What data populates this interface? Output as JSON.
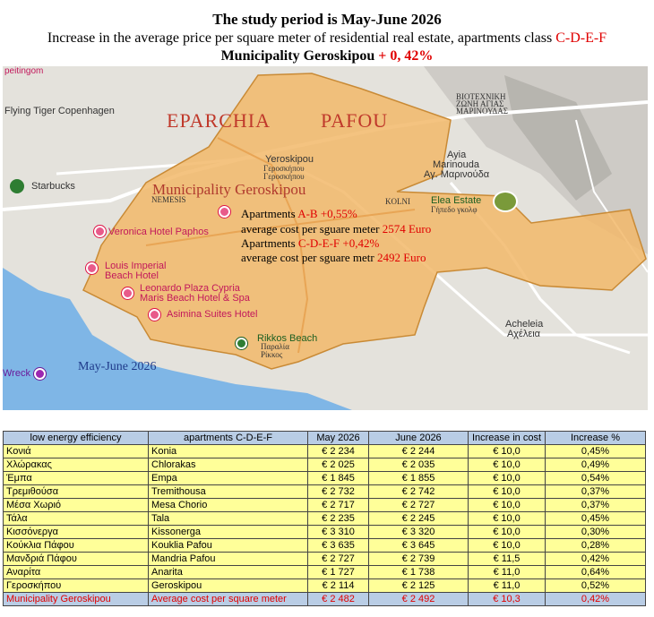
{
  "header": {
    "line1": "The study period is May-June 2026",
    "line2_text": "Increase in the average price per square meter of residential real estate, apartments class ",
    "line2_class": "C-D-E-F",
    "line3_text": "Municipality Geroskipou ",
    "line3_value": "+ 0, 42%"
  },
  "map": {
    "eparchia_left": "EPARCHIA",
    "eparchia_right": "PAFOU",
    "municipality": "Municipality Geroskipou",
    "period": "May-June 2026",
    "ab_label": "Apartments ",
    "ab_class": "A-B +0,55%",
    "ab_cost_label": "average cost per sguare meter ",
    "ab_cost_value": "2574 Euro",
    "cdef_label": "Apartments ",
    "cdef_class": "C-D-E-F +0,42%",
    "cdef_cost_label": "average cost per sguare metr ",
    "cdef_cost_value": "2492 Euro",
    "places": {
      "top_left": "peitingom",
      "flying_tiger": "Flying Tiger Copenhagen",
      "starbucks": "Starbucks",
      "veronica": "Veronica Hotel Paphos",
      "louis_1": "Louis Imperial",
      "louis_2": "Beach Hotel",
      "leonardo_1": "Leonardo Plaza Cypria",
      "leonardo_2": "Maris Beach Hotel & Spa",
      "asimina": "Asimina Suites Hotel",
      "rikkos": "Rikkos Beach",
      "rikkos_gr1": "Παραλία",
      "rikkos_gr2": "Ρίκκος",
      "geroskipou": "Yeroskipou",
      "geroskipou_gr1": "Γεροσκήπου",
      "geroskipou_gr2": "Γεροσκήπου",
      "ayia_1": "Ayia",
      "ayia_2": "Marinouda",
      "ayia_gr": "Αγ. Μαρινούδα",
      "elea": "Elea Estate",
      "elea_gr": "Γήπεδο γκολφ",
      "industrial_1": "ΒΙΟΤΕΧΝΙΚΗ",
      "industrial_2": "ΖΩΝΗ ΑΓΙΑΣ",
      "industrial_3": "ΜΑΡΙΝΟΥΔΑΣ",
      "acheleia": "Acheleia",
      "acheleia_gr": "Αχέλεια",
      "wreck": "Wreck",
      "kolni": "KOLNI",
      "nemesis": "NEMESIS"
    }
  },
  "table": {
    "columns": [
      "low energy efficiency",
      "apartments C-D-E-F",
      "May 2026",
      "June 2026",
      "Increase in cost",
      "Increase %"
    ],
    "rows": [
      [
        "Κονιά",
        "Konia",
        "€ 2 234",
        "€ 2 244",
        "€ 10,0",
        "0,45%"
      ],
      [
        "Χλώρακας",
        "Chlorakas",
        "€ 2 025",
        "€ 2 035",
        "€ 10,0",
        "0,49%"
      ],
      [
        "Έμπα",
        "Empa",
        "€ 1 845",
        "€ 1 855",
        "€ 10,0",
        "0,54%"
      ],
      [
        "Τρεμιθούσα",
        "Tremithousa",
        "€ 2 732",
        "€ 2 742",
        "€ 10,0",
        "0,37%"
      ],
      [
        "Μέσα Χωριό",
        "Mesa Chorio",
        "€ 2 717",
        "€ 2 727",
        "€ 10,0",
        "0,37%"
      ],
      [
        "Τάλα",
        "Tala",
        "€ 2 235",
        "€ 2 245",
        "€ 10,0",
        "0,45%"
      ],
      [
        "Κισσόνεργα",
        "Kissonerga",
        "€ 3 310",
        "€ 3 320",
        "€ 10,0",
        "0,30%"
      ],
      [
        "Κούκλια Πάφου",
        "Kouklia Pafou",
        "€ 3 635",
        "€ 3 645",
        "€ 10,0",
        "0,28%"
      ],
      [
        "Μανδριά Πάφου",
        "Mandria Pafou",
        "€ 2 727",
        "€ 2 739",
        "€ 11,5",
        "0,42%"
      ],
      [
        "Αναρίτα",
        "Anarita",
        "€ 1 727",
        "€ 1 738",
        "€ 11,0",
        "0,64%"
      ],
      [
        "Γεροσκήπου",
        "Geroskipou",
        "€ 2 114",
        "€ 2 125",
        "€ 11,0",
        "0,52%"
      ]
    ],
    "total": [
      "Municipality Geroskipou",
      "Average cost per square meter",
      "€ 2 482",
      "€ 2 492",
      "€ 10,3",
      "0,42%"
    ]
  },
  "colors": {
    "highlight": "#e00000",
    "area_fill": "#f2b86a",
    "sea": "#7fb6e6",
    "table_row": "#ffff99",
    "table_header": "#b9cde5"
  }
}
